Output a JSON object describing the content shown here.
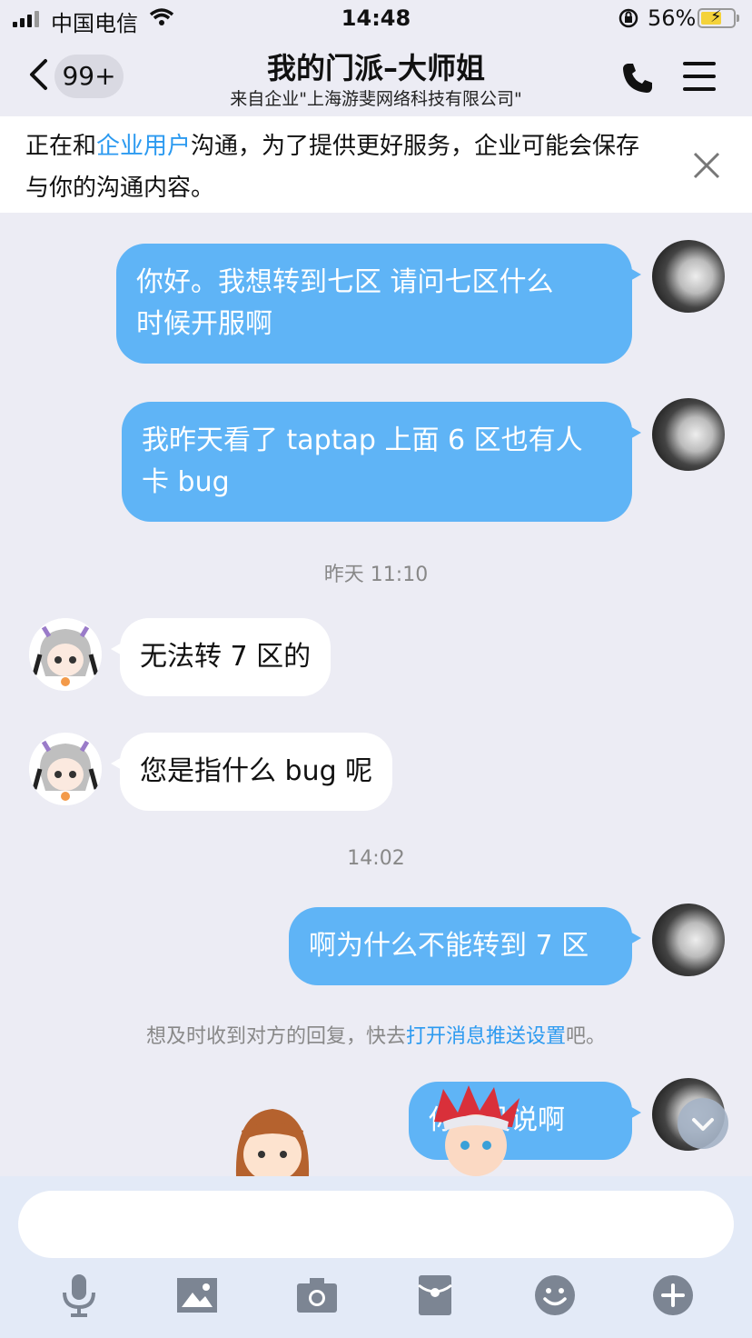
{
  "status_bar": {
    "carrier": "中国电信",
    "time": "14:48",
    "battery": "56%"
  },
  "nav": {
    "unread_badge": "99+",
    "title": "我的门派–大师姐",
    "subtitle": "来自企业\"上海游斐网络科技有限公司\""
  },
  "notice": {
    "text_before": "正在和",
    "link": "企业用户",
    "text_after": "沟通，为了提供更好服务，企业可能会保存与你的沟通内容。"
  },
  "messages": [
    {
      "from": "me",
      "line1": "你好。我想转到七区 请问七区什么",
      "line2": "时候开服啊"
    },
    {
      "from": "me",
      "line1": "我昨天看了 taptap 上面 6 区也有人",
      "line2": "卡 bug"
    },
    {
      "from": "them",
      "text": "无法转 7 区的"
    },
    {
      "from": "them",
      "text": "您是指什么 bug 呢"
    },
    {
      "from": "me",
      "text": "啊为什么不能转到 7 区"
    },
    {
      "from": "me",
      "text": "你…没说啊"
    }
  ],
  "timestamps": {
    "t1": "昨天 11:10",
    "t2": "14:02"
  },
  "push_hint": {
    "before": "想及时收到对方的回复，快去",
    "link": "打开消息推送设置",
    "after": "吧。"
  },
  "input": {
    "placeholder": ""
  },
  "colors": {
    "accent": "#2c9af0",
    "my_bubble": "#5fb4f6",
    "background": "#ececf4"
  }
}
